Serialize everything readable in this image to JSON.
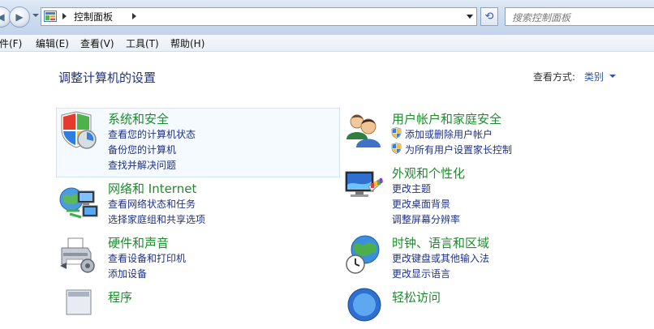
{
  "address_bar": {
    "path_label": "控制面板",
    "search_placeholder": "搜索控制面板"
  },
  "menu": {
    "file": "文件(F)",
    "edit": "编辑(E)",
    "view": "查看(V)",
    "tools": "工具(T)",
    "help": "帮助(H)"
  },
  "page": {
    "title": "调整计算机的设置",
    "view_by_label": "查看方式:",
    "view_by_value": "类别"
  },
  "categories": {
    "system_security": {
      "title": "系统和安全",
      "links": [
        "查看您的计算机状态",
        "备份您的计算机",
        "查找并解决问题"
      ]
    },
    "network": {
      "title": "网络和 Internet",
      "links": [
        "查看网络状态和任务",
        "选择家庭组和共享选项"
      ]
    },
    "hardware": {
      "title": "硬件和声音",
      "links": [
        "查看设备和打印机",
        "添加设备"
      ]
    },
    "programs": {
      "title": "程序"
    },
    "user_accounts": {
      "title": "用户帐户和家庭安全",
      "links": [
        "添加或删除用户帐户",
        "为所有用户设置家长控制"
      ]
    },
    "appearance": {
      "title": "外观和个性化",
      "links": [
        "更改主题",
        "更改桌面背景",
        "调整屏幕分辨率"
      ]
    },
    "clock_region": {
      "title": "时钟、语言和区域",
      "links": [
        "更改键盘或其他输入法",
        "更改显示语言"
      ]
    },
    "ease_access": {
      "title": "轻松访问"
    }
  },
  "icons": {
    "back": "back-arrow-icon",
    "forward": "forward-arrow-icon",
    "refresh": "refresh-icon",
    "uac_shield": "uac-shield-icon"
  },
  "colors": {
    "category_title": "#1d8c2c",
    "link": "#1e3287",
    "chrome": "#cddbee"
  }
}
